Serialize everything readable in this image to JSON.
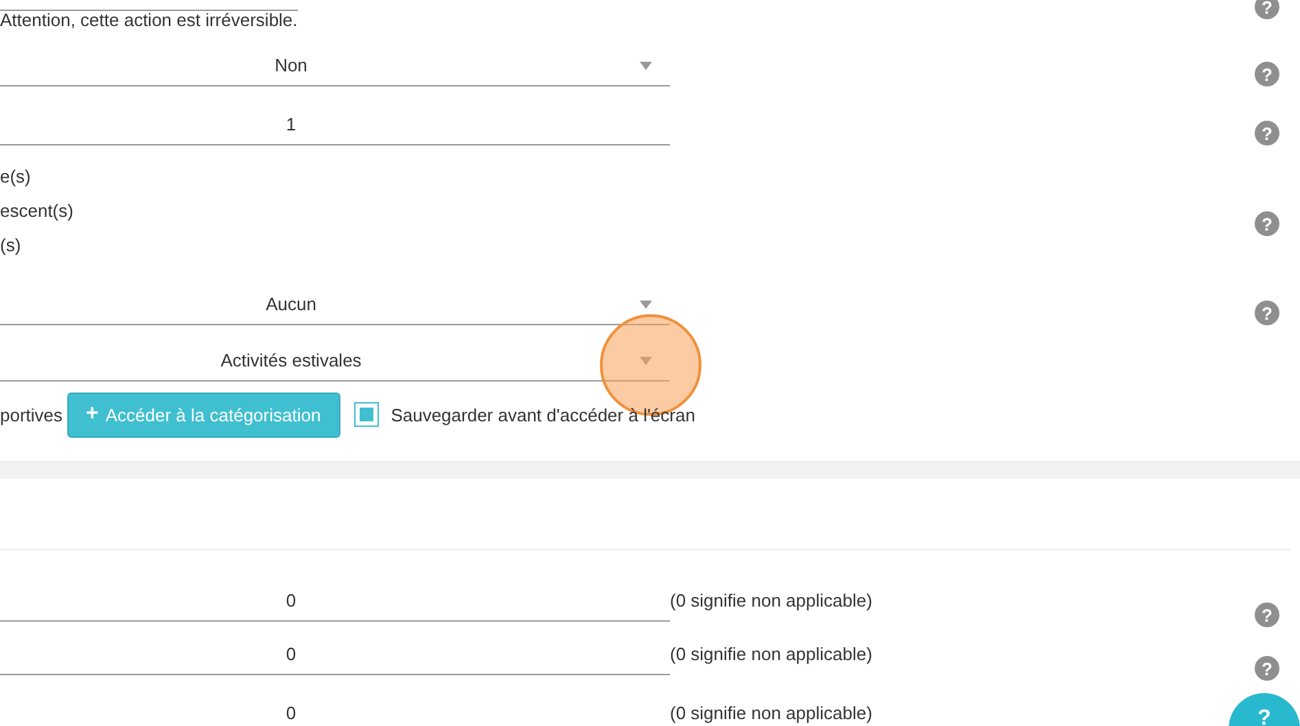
{
  "section1": [
    {
      "kind": "note",
      "text": "Attention, cette action est irréversible.",
      "help": "?"
    },
    {
      "kind": "select",
      "value": "Non",
      "help": "?"
    },
    {
      "kind": "input",
      "value": "1",
      "help": "?"
    },
    {
      "kind": "checklist",
      "lines": [
        "e(s)",
        "escent(s)",
        "(s)"
      ],
      "help": "?"
    },
    {
      "kind": "select",
      "value": "Aucun",
      "help": "?"
    },
    {
      "kind": "select",
      "value": "Activités estivales"
    },
    {
      "kind": "actions",
      "label": "portives",
      "button": "Accéder à la catégorisation",
      "button_icon": "+",
      "checkbox": {
        "label": "Sauvegarder avant d'accéder à l'écran",
        "checked": true
      }
    }
  ],
  "section2": [
    {
      "kind": "input",
      "value": "0",
      "hint": "(0 signifie non applicable)",
      "help": "?"
    },
    {
      "kind": "input",
      "value": "0",
      "hint": "(0 signifie non applicable)",
      "help": "?"
    },
    {
      "kind": "input",
      "value": "0",
      "hint": "(0 signifie non applicable)"
    }
  ],
  "floating_help": {
    "label": "?"
  }
}
